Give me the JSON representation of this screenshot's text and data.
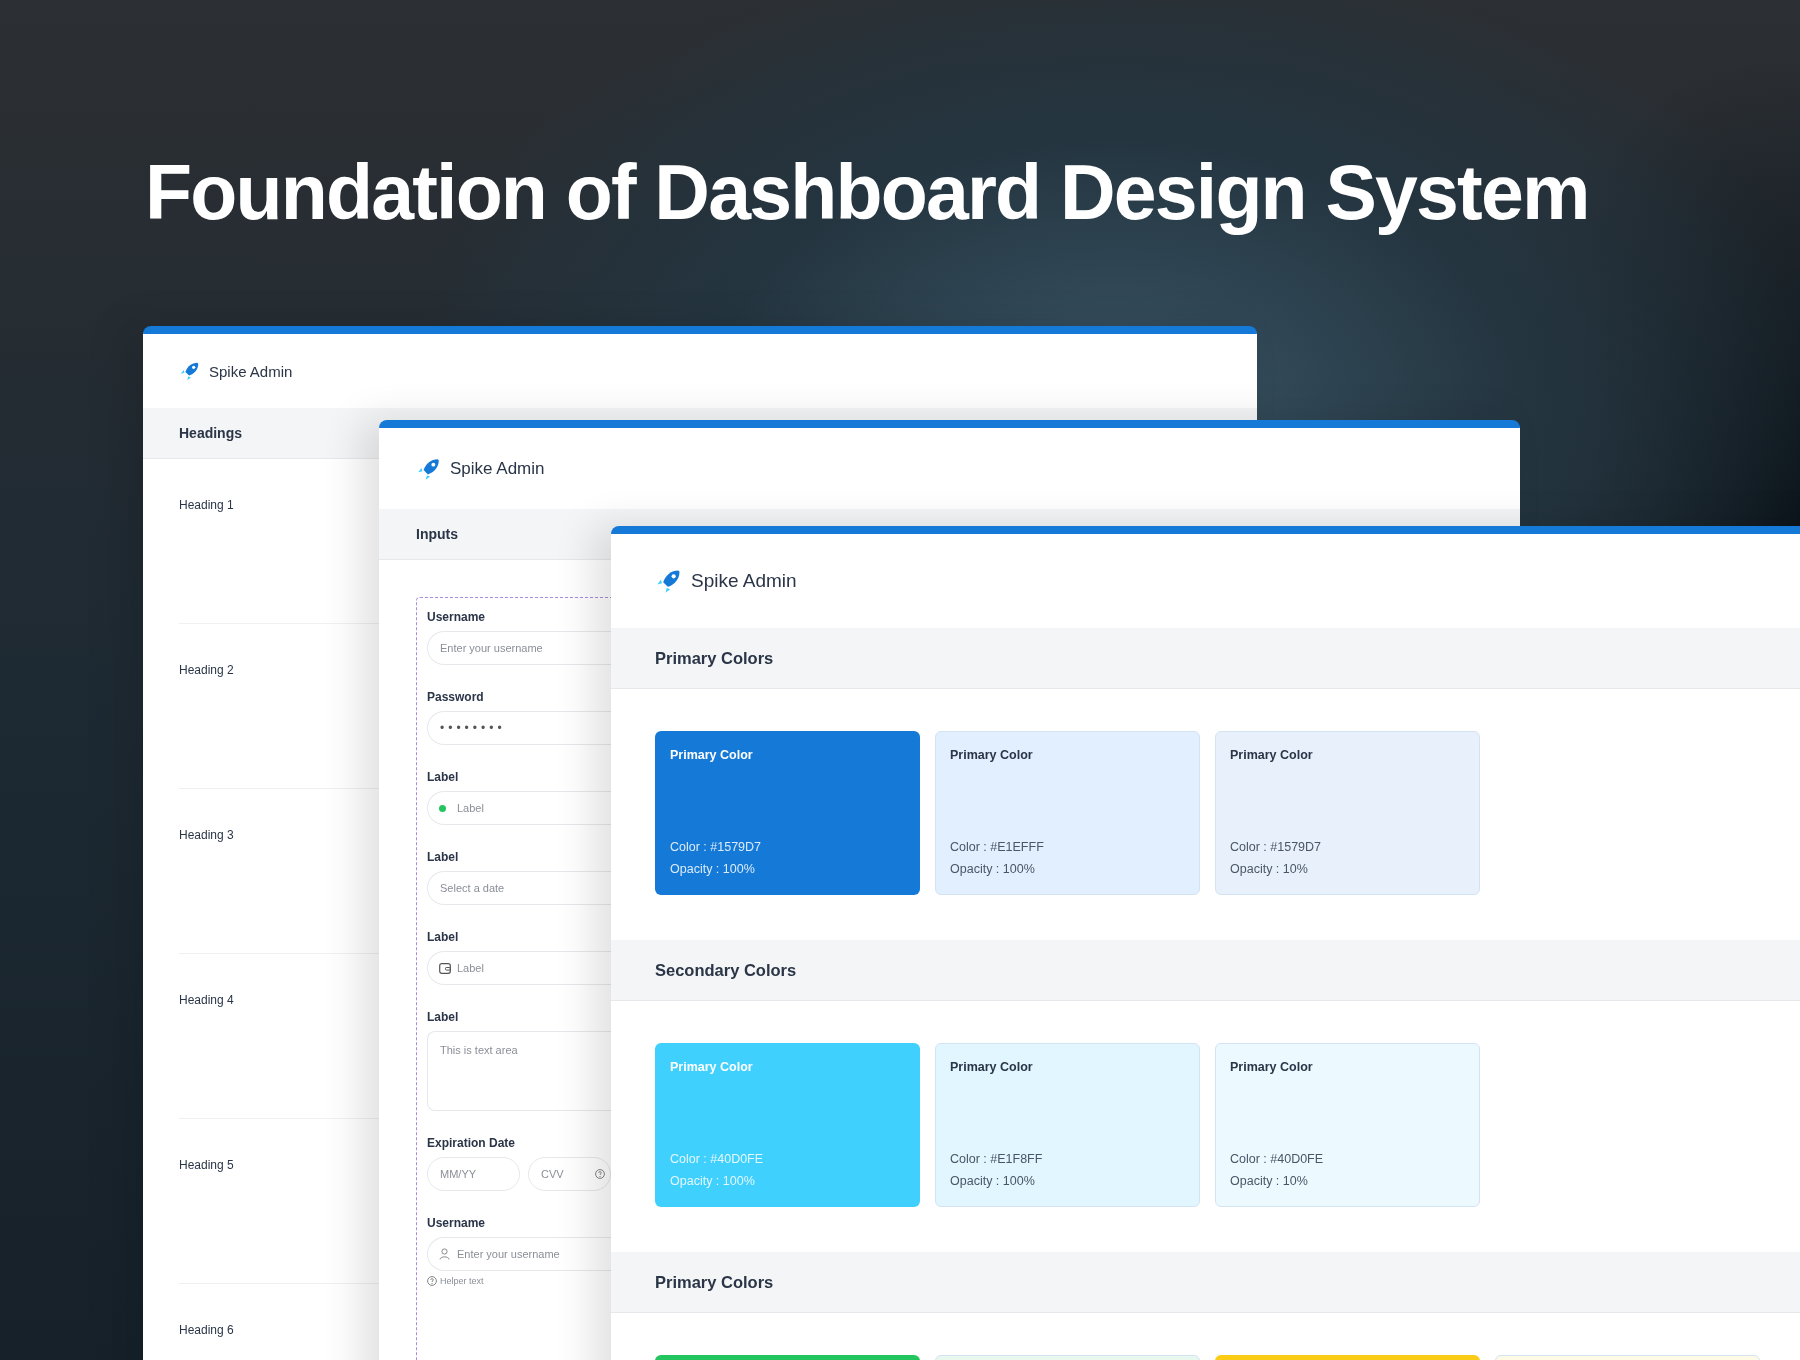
{
  "headline": "Foundation of Dashboard Design System",
  "windows": [
    {
      "kind": "headings",
      "app": "Spike Admin",
      "section": "Headings",
      "rows": [
        "Heading 1",
        "Heading 2",
        "Heading 3",
        "Heading 4",
        "Heading 5",
        "Heading 6"
      ]
    },
    {
      "kind": "inputs",
      "app": "Spike Admin",
      "section": "Inputs",
      "fields": [
        {
          "kind": "text",
          "label": "Username",
          "placeholder": "Enter your username"
        },
        {
          "kind": "password",
          "label": "Password",
          "value": "••••••••"
        },
        {
          "kind": "dot",
          "label": "Label",
          "placeholder": "Label"
        },
        {
          "kind": "text",
          "label": "Label",
          "placeholder": "Select a date"
        },
        {
          "kind": "wallet",
          "label": "Label",
          "placeholder": "Label"
        },
        {
          "kind": "textarea",
          "label": "Label",
          "placeholder": "This is text area"
        },
        {
          "kind": "pair",
          "label": "Expiration Date",
          "placeholders": [
            "MM/YY",
            "CVV"
          ]
        },
        {
          "kind": "user",
          "label": "Username",
          "placeholder": "Enter your username",
          "helper": "Helper text"
        }
      ]
    },
    {
      "kind": "colors",
      "app": "Spike Admin",
      "sections": [
        {
          "title": "Primary Colors",
          "swatches": [
            {
              "name": "Primary Color",
              "code": "Color : #1579D7",
              "opacity": "Opacity : 100%",
              "color": "#1579d7"
            },
            {
              "name": "Primary Color",
              "code": "Color : #E1EFFF",
              "opacity": "Opacity : 100%",
              "color": "#e1efff"
            },
            {
              "name": "Primary Color",
              "code": "Color : #1579D7",
              "opacity": "Opacity : 10%",
              "color": "#e8f1fb"
            }
          ]
        },
        {
          "title": "Secondary Colors",
          "swatches": [
            {
              "name": "Primary Color",
              "code": "Color : #40D0FE",
              "opacity": "Opacity : 100%",
              "color": "#40d0fe"
            },
            {
              "name": "Primary Color",
              "code": "Color : #E1F8FF",
              "opacity": "Opacity : 100%",
              "color": "#e1f6ff"
            },
            {
              "name": "Primary Color",
              "code": "Color : #40D0FE",
              "opacity": "Opacity : 10%",
              "color": "#ecfaff"
            }
          ]
        },
        {
          "title": "Primary Colors",
          "swatches": [
            {
              "color": "#22c55e"
            },
            {
              "color": "#e8f8ee"
            },
            {
              "color": "#facc15"
            },
            {
              "color": "#fdfbe6"
            }
          ]
        }
      ]
    }
  ]
}
